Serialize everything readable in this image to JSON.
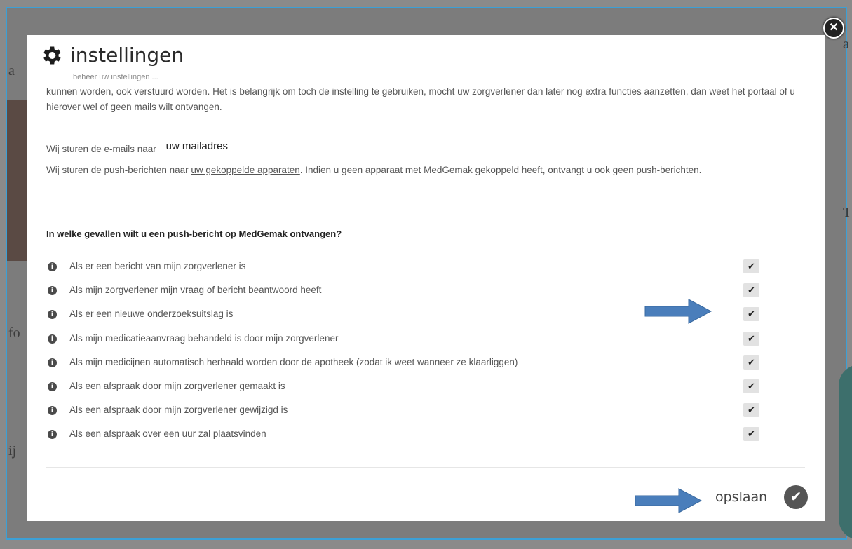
{
  "modal": {
    "title": "instellingen",
    "subtitle": "beheer uw instellingen ..."
  },
  "content": {
    "intro": "kunnen worden, ook verstuurd worden. Het is belangrijk om toch de instelling te gebruiken, mocht uw zorgverlener dan later nog extra functies aanzetten, dan weet het portaal of u hierover wel of geen mails wilt ontvangen.",
    "mail_prefix": "Wij sturen de e-mails naar",
    "mail_address": "uw mailadres",
    "push_prefix": "Wij sturen de push-berichten naar",
    "push_link": "uw gekoppelde apparaten",
    "push_suffix": ". Indien u geen apparaat met MedGemak gekoppeld heeft, ontvangt u ook geen push-berichten.",
    "question": "In welke gevallen wilt u een push-bericht op MedGemak ontvangen?"
  },
  "options": [
    {
      "label": "Als er een bericht van mijn zorgverlener is",
      "checked": true
    },
    {
      "label": "Als mijn zorgverlener mijn vraag of bericht beantwoord heeft",
      "checked": true
    },
    {
      "label": "Als er een nieuwe onderzoeksuitslag is",
      "checked": true
    },
    {
      "label": "Als mijn medicatieaanvraag behandeld is door mijn zorgverlener",
      "checked": true
    },
    {
      "label": "Als mijn medicijnen automatisch herhaald worden door de apotheek (zodat ik weet wanneer ze klaarliggen)",
      "checked": true
    },
    {
      "label": "Als een afspraak door mijn zorgverlener gemaakt is",
      "checked": true
    },
    {
      "label": "Als een afspraak door mijn zorgverlener gewijzigd is",
      "checked": true
    },
    {
      "label": "Als een afspraak over een uur zal plaatsvinden",
      "checked": true
    }
  ],
  "footer": {
    "save_label": "opslaan"
  },
  "icons": {
    "gear": "gear-icon",
    "info": "info-icon",
    "check": "check-icon",
    "close": "close-icon",
    "arrow": "arrow-right-icon"
  },
  "colors": {
    "arrow": "#4a7ebb",
    "checkbox_bg": "#e2e2e2",
    "save_circle": "#555555"
  }
}
